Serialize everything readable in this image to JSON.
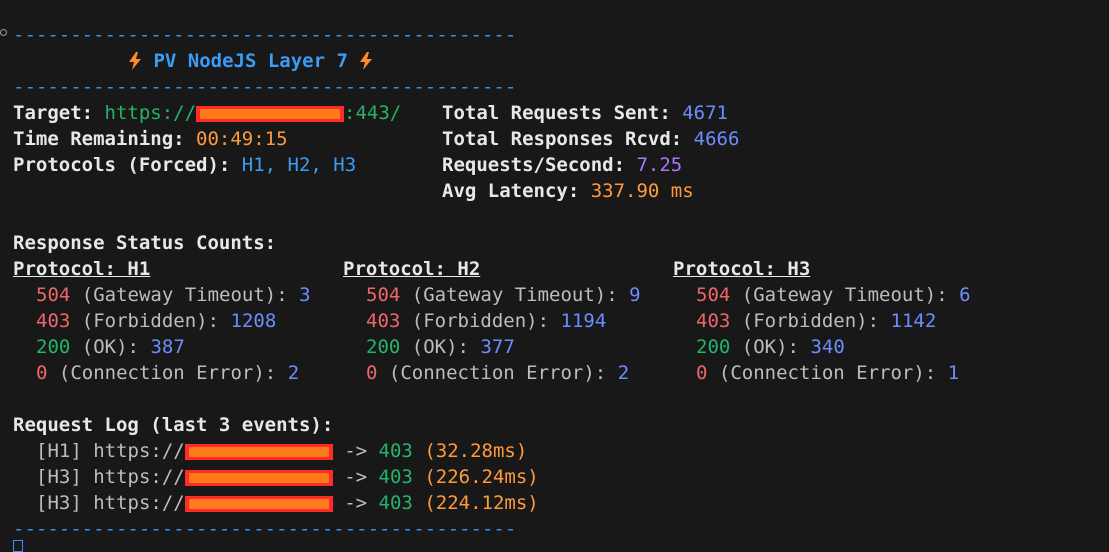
{
  "colors": {
    "background": "#181818",
    "divider": "#3b8eea",
    "label": "#e8e8e8",
    "url": "#23b36b",
    "time": "#ff9a3c",
    "protocols": "#3b9cf6",
    "number": "#6d8dff",
    "rps": "#b074ff",
    "status_504": "#f0656b",
    "status_403": "#f0656b",
    "status_200": "#23b36b",
    "status_0": "#f0656b",
    "redaction": "#ff2b2b"
  },
  "divider": "--------------------------------------------",
  "banner": {
    "icon_left": "bolt-icon",
    "title": "PV NodeJS Layer 7",
    "icon_right": "bolt-icon"
  },
  "stats_left": {
    "target_label": "Target:",
    "target_prefix": "https://",
    "target_suffix": ":443/",
    "time_label": "Time Remaining:",
    "time_value": "00:49:15",
    "protocols_label": "Protocols (Forced):",
    "protocols_value": "H1, H2, H3"
  },
  "stats_right": {
    "sent_label": "Total Requests Sent:",
    "sent_value": "4671",
    "rcvd_label": "Total Responses Rcvd:",
    "rcvd_value": "4666",
    "rps_label": "Requests/Second:",
    "rps_value": "7.25",
    "latency_label": "Avg Latency:",
    "latency_value": "337.90 ms"
  },
  "status_heading": "Response Status Counts:",
  "protocols": [
    {
      "header": "Protocol: H1",
      "rows": [
        {
          "code": "504",
          "desc": "(Gateway Timeout):",
          "count": "3"
        },
        {
          "code": "403",
          "desc": "(Forbidden):",
          "count": "1208"
        },
        {
          "code": "200",
          "desc": "(OK):",
          "count": "387"
        },
        {
          "code": "0",
          "desc": "(Connection Error):",
          "count": "2"
        }
      ]
    },
    {
      "header": "Protocol: H2",
      "rows": [
        {
          "code": "504",
          "desc": "(Gateway Timeout):",
          "count": "9"
        },
        {
          "code": "403",
          "desc": "(Forbidden):",
          "count": "1194"
        },
        {
          "code": "200",
          "desc": "(OK):",
          "count": "377"
        },
        {
          "code": "0",
          "desc": "(Connection Error):",
          "count": "2"
        }
      ]
    },
    {
      "header": "Protocol: H3",
      "rows": [
        {
          "code": "504",
          "desc": "(Gateway Timeout):",
          "count": "6"
        },
        {
          "code": "403",
          "desc": "(Forbidden):",
          "count": "1142"
        },
        {
          "code": "200",
          "desc": "(OK):",
          "count": "340"
        },
        {
          "code": "0",
          "desc": "(Connection Error):",
          "count": "1"
        }
      ]
    }
  ],
  "log_heading": "Request Log (last 3 events):",
  "log": [
    {
      "proto": "[H1]",
      "prefix": "https://",
      "arrow": "->",
      "status": "403",
      "latency": "(32.28ms)"
    },
    {
      "proto": "[H3]",
      "prefix": "https://",
      "arrow": "->",
      "status": "403",
      "latency": "(226.24ms)"
    },
    {
      "proto": "[H3]",
      "prefix": "https://",
      "arrow": "->",
      "status": "403",
      "latency": "(224.12ms)"
    }
  ]
}
